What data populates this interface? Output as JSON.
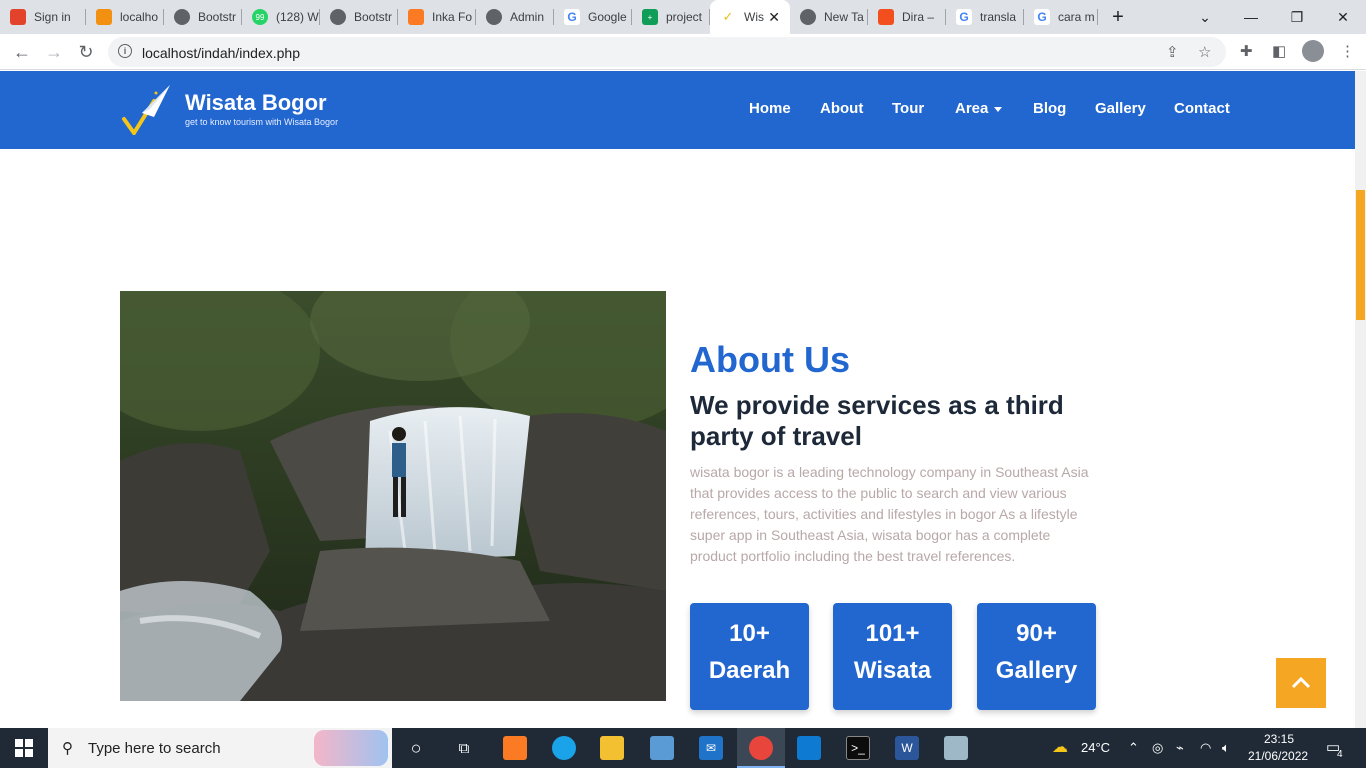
{
  "browser": {
    "tabs": [
      {
        "label": "Sign in",
        "icon": "gitlab-icon"
      },
      {
        "label": "localho",
        "icon": "phpmyadmin-icon"
      },
      {
        "label": "Bootstr",
        "icon": "globe-icon"
      },
      {
        "label": "(128) W",
        "icon": "whatsapp-icon"
      },
      {
        "label": "Bootstr",
        "icon": "globe-icon"
      },
      {
        "label": "Inka Fo",
        "icon": "xampp-icon"
      },
      {
        "label": "Admin",
        "icon": "globe-icon"
      },
      {
        "label": "Google",
        "icon": "google-icon"
      },
      {
        "label": "project",
        "icon": "sheets-icon"
      },
      {
        "label": "Wis",
        "icon": "site-icon",
        "active": true
      },
      {
        "label": "New Ta",
        "icon": "chrome-icon"
      },
      {
        "label": "Dira –",
        "icon": "figma-icon"
      },
      {
        "label": "transla",
        "icon": "google-icon"
      },
      {
        "label": "cara m",
        "icon": "google-icon"
      }
    ],
    "url": "localhost/indah/index.php"
  },
  "site": {
    "brand": "Wisata Bogor",
    "tagline": "get to know tourism with Wisata Bogor",
    "nav": {
      "home": "Home",
      "about": "About",
      "tour": "Tour",
      "area": "Area",
      "blog": "Blog",
      "gallery": "Gallery",
      "contact": "Contact"
    },
    "about": {
      "title": "About Us",
      "subtitle": "We provide services as a third party of travel",
      "description": "wisata bogor is a leading technology company in Southeast Asia that provides access to the public to search and view various references, tours, activities and lifestyles in bogor As a lifestyle super app in Southeast Asia, wisata bogor has a complete product portfolio including the best travel references."
    },
    "stats": [
      {
        "number": "10+",
        "label": "Daerah"
      },
      {
        "number": "101+",
        "label": "Wisata"
      },
      {
        "number": "90+",
        "label": "Gallery"
      }
    ],
    "colors": {
      "primary": "#2266d0",
      "accent": "#f5a623"
    }
  },
  "taskbar": {
    "search_placeholder": "Type here to search",
    "weather": "24°C",
    "time": "23:15",
    "date": "21/06/2022",
    "notifications": "4"
  }
}
